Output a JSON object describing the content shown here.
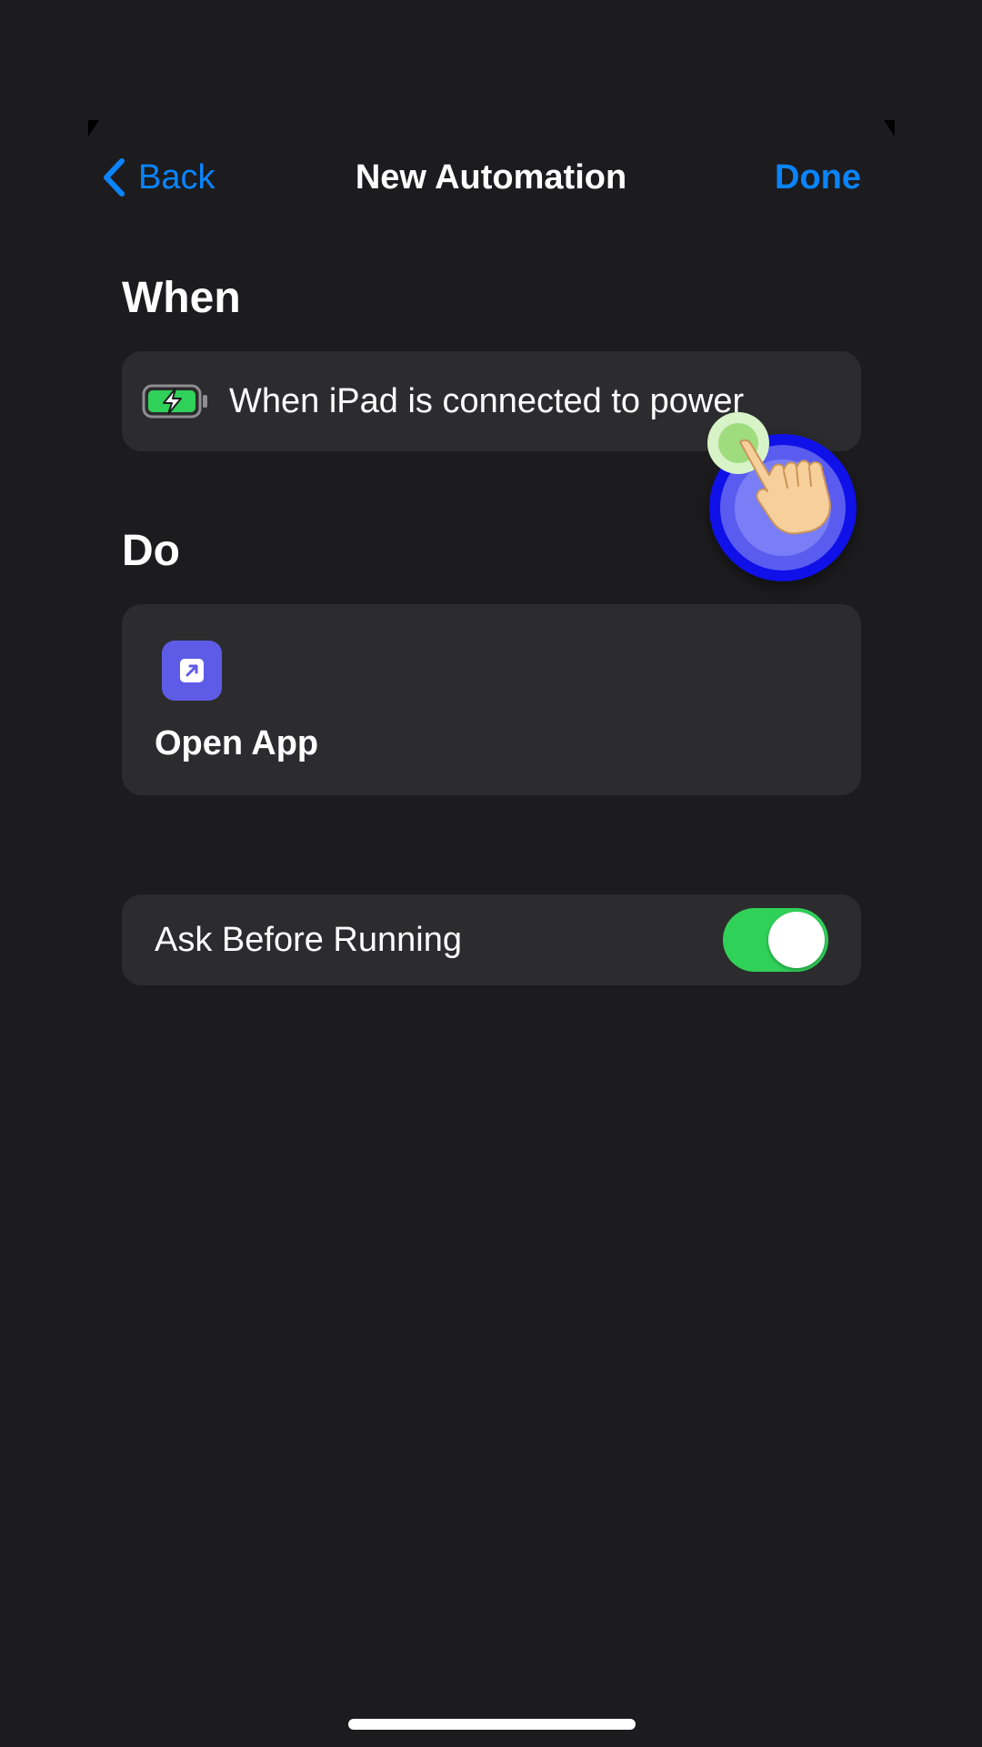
{
  "nav": {
    "back_label": "Back",
    "title": "New Automation",
    "done_label": "Done"
  },
  "when": {
    "heading": "When",
    "trigger_icon": "battery-charging-icon",
    "trigger_label": "When iPad is connected to power"
  },
  "do": {
    "heading": "Do",
    "action_icon": "open-app-icon",
    "action_label": "Open App"
  },
  "settings": {
    "ask_before_running_label": "Ask Before Running",
    "ask_before_running_on": true
  },
  "colors": {
    "background": "#1c1c1e",
    "card": "#2c2c2e",
    "accent": "#0a84ff",
    "toggle_on": "#30d158",
    "open_app_icon": "#5e5ce6",
    "battery_green": "#30d158"
  }
}
